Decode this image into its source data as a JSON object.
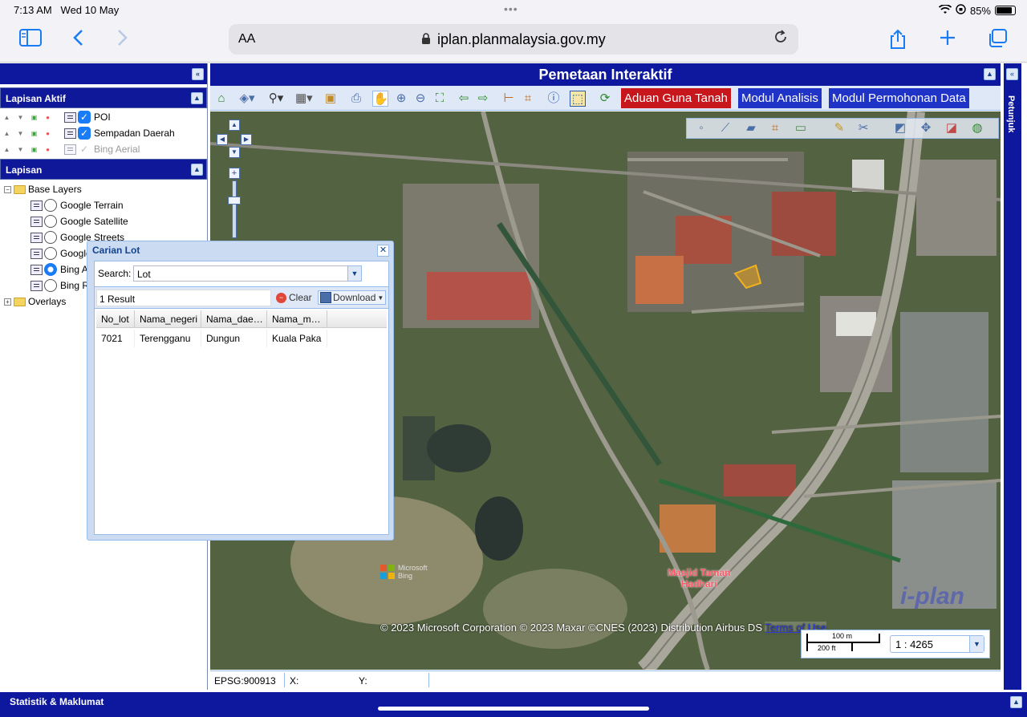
{
  "statusbar": {
    "time": "7:13 AM",
    "date": "Wed 10 May",
    "dots": "•••",
    "battery": "85%",
    "battery_level": 0.85
  },
  "safari": {
    "aa_label": "AA",
    "url": "iplan.planmalaysia.gov.my"
  },
  "left": {
    "lapisan_aktif_title": "Lapisan Aktif",
    "active_layers": [
      {
        "label": "POI",
        "checked": true
      },
      {
        "label": "Sempadan Daerah",
        "checked": true
      },
      {
        "label": "Bing Aerial",
        "checked": false
      }
    ],
    "lapisan_title": "Lapisan",
    "base_layers_label": "Base Layers",
    "base_layers": [
      {
        "label": "Google Terrain"
      },
      {
        "label": "Google Satellite"
      },
      {
        "label": "Google Streets"
      },
      {
        "label": "Google"
      },
      {
        "label": "Bing A",
        "selected": true
      },
      {
        "label": "Bing R"
      }
    ],
    "overlays_label": "Overlays"
  },
  "map": {
    "title": "Pemetaan Interaktif",
    "aduan_button": "Aduan Guna Tanah",
    "analisis_button": "Modul Analisis",
    "permohonan_button": "Modul Permohonan Data",
    "copyright": "© 2023 Microsoft Corporation © 2023 Maxar ©CNES (2023) Distribution Airbus DS",
    "terms_link": "Terms of Use",
    "poi_label_line1": "Masjid Taman",
    "poi_label_line2": "Hadhari",
    "bing_logo_text": "Microsoft Bing",
    "watermark": "i-plan",
    "scale_m": "100 m",
    "scale_ft": "200 ft",
    "scale_ratio": "1 : 4265",
    "epsg": "EPSG:900913",
    "x_label": "X:",
    "y_label": "Y:"
  },
  "right_strip_label": "Petunjuk",
  "bottom_bar_label": "Statistik & Maklumat",
  "dialog": {
    "title": "Carian Lot",
    "search_label": "Search:",
    "search_value": "Lot",
    "result_count": "1 Result",
    "clear_label": "Clear",
    "download_label": "Download",
    "columns": [
      "No_lot",
      "Nama_negeri",
      "Nama_dae…",
      "Nama_m…"
    ],
    "rows": [
      [
        "7021",
        "Terengganu",
        "Dungun",
        "Kuala Paka"
      ]
    ]
  }
}
